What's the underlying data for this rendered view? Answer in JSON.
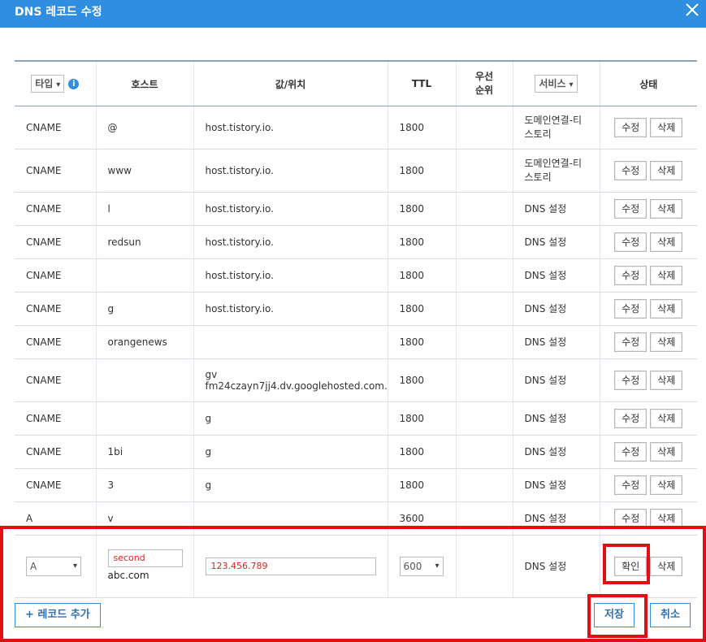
{
  "dialog": {
    "title": "DNS 레코드 수정"
  },
  "header": {
    "type_select": "타입",
    "host": "호스트",
    "value": "값/위치",
    "ttl": "TTL",
    "priority": "우선\n순위",
    "service_select": "서비스",
    "status": "상태"
  },
  "rows": [
    {
      "type": "CNAME",
      "host": "@",
      "value": "host.tistory.io.",
      "ttl": "1800",
      "service": "도메인연결-티\n스토리",
      "edit": "수정",
      "delete": "삭제"
    },
    {
      "type": "CNAME",
      "host": "www",
      "value": "host.tistory.io.",
      "ttl": "1800",
      "service": "도메인연결-티\n스토리",
      "edit": "수정",
      "delete": "삭제"
    },
    {
      "type": "CNAME",
      "host": "l",
      "value": "host.tistory.io.",
      "ttl": "1800",
      "service": "DNS 설정",
      "edit": "수정",
      "delete": "삭제"
    },
    {
      "type": "CNAME",
      "host": "redsun",
      "value": "host.tistory.io.",
      "ttl": "1800",
      "service": "DNS 설정",
      "edit": "수정",
      "delete": "삭제"
    },
    {
      "type": "CNAME",
      "host": "",
      "value": "host.tistory.io.",
      "ttl": "1800",
      "service": "DNS 설정",
      "edit": "수정",
      "delete": "삭제"
    },
    {
      "type": "CNAME",
      "host": "g",
      "value": "host.tistory.io.",
      "ttl": "1800",
      "service": "DNS 설정",
      "edit": "수정",
      "delete": "삭제"
    },
    {
      "type": "CNAME",
      "host": "orangenews",
      "value": "",
      "ttl": "1800",
      "service": "DNS 설정",
      "edit": "수정",
      "delete": "삭제"
    },
    {
      "type": "CNAME",
      "host": "",
      "value": "gv\nfm24czayn7jj4.dv.googlehosted.com.",
      "ttl": "1800",
      "service": "DNS 설정",
      "edit": "수정",
      "delete": "삭제"
    },
    {
      "type": "CNAME",
      "host": "",
      "value": "g",
      "ttl": "1800",
      "service": "DNS 설정",
      "edit": "수정",
      "delete": "삭제"
    },
    {
      "type": "CNAME",
      "host": "1bi",
      "value": "g",
      "ttl": "1800",
      "service": "DNS 설정",
      "edit": "수정",
      "delete": "삭제"
    },
    {
      "type": "CNAME",
      "host": "3",
      "value": "g",
      "ttl": "1800",
      "service": "DNS 설정",
      "edit": "수정",
      "delete": "삭제"
    },
    {
      "type": "A",
      "host": "v",
      "value": "",
      "ttl": "3600",
      "service": "DNS 설정",
      "edit": "수정",
      "delete": "삭제"
    }
  ],
  "edit_row": {
    "type": "A",
    "host_value": "second",
    "host_suffix": "abc.com",
    "value": "123.456.789",
    "ttl": "600",
    "service": "DNS 설정",
    "confirm": "확인",
    "delete": "삭제"
  },
  "footer": {
    "add_record": "+ 레코드 추가",
    "save": "저장",
    "cancel": "취소"
  },
  "colors": {
    "header_bar": "#2f8ee0",
    "highlight": "#e01010"
  }
}
